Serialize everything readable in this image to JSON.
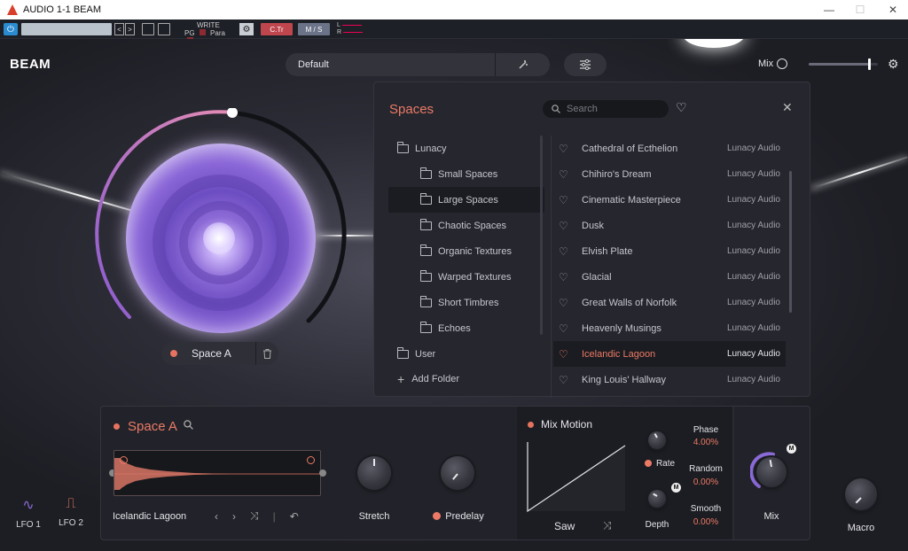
{
  "window": {
    "title": "AUDIO 1-1 BEAM",
    "minimize": "—",
    "maximize": "☐",
    "close": "✕"
  },
  "host": {
    "power": "⏻",
    "prev": "<",
    "next": ">",
    "write_label": "WRITE",
    "pg_label": "PG",
    "para_label": "Para",
    "gear": "⚙",
    "ctr_label": "C.Tr",
    "ms_label": "M / S",
    "l_label": "L",
    "r_label": "R"
  },
  "header": {
    "logo": "BEAM",
    "preset_name": "Default",
    "wand": "⁄̸",
    "mix_label": "Mix",
    "mix_fraction": 0.87
  },
  "space_pill": {
    "label": "Space A",
    "trash": "🗑"
  },
  "spaces_panel": {
    "title": "Spaces",
    "search_placeholder": "Search",
    "folders": [
      {
        "label": "Lunacy",
        "child": false,
        "active": false
      },
      {
        "label": "Small Spaces",
        "child": true,
        "active": false
      },
      {
        "label": "Large Spaces",
        "child": true,
        "active": true
      },
      {
        "label": "Chaotic Spaces",
        "child": true,
        "active": false
      },
      {
        "label": "Organic Textures",
        "child": true,
        "active": false
      },
      {
        "label": "Warped Textures",
        "child": true,
        "active": false
      },
      {
        "label": "Short Timbres",
        "child": true,
        "active": false
      },
      {
        "label": "Echoes",
        "child": true,
        "active": false
      },
      {
        "label": "User",
        "child": false,
        "active": false
      }
    ],
    "add_folder": "Add Folder",
    "presets": [
      {
        "name": "Cathedral of Ecthelion",
        "author": "Lunacy Audio",
        "active": false
      },
      {
        "name": "Chihiro's Dream",
        "author": "Lunacy Audio",
        "active": false
      },
      {
        "name": "Cinematic Masterpiece",
        "author": "Lunacy Audio",
        "active": false
      },
      {
        "name": "Dusk",
        "author": "Lunacy Audio",
        "active": false
      },
      {
        "name": "Elvish Plate",
        "author": "Lunacy Audio",
        "active": false
      },
      {
        "name": "Glacial",
        "author": "Lunacy Audio",
        "active": false
      },
      {
        "name": "Great Walls of Norfolk",
        "author": "Lunacy Audio",
        "active": false
      },
      {
        "name": "Heavenly Musings",
        "author": "Lunacy Audio",
        "active": false
      },
      {
        "name": "Icelandic Lagoon",
        "author": "Lunacy Audio",
        "active": true
      },
      {
        "name": "King Louis' Hallway",
        "author": "Lunacy Audio",
        "active": false
      }
    ]
  },
  "space_section": {
    "title": "Space A",
    "sample_name": "Icelandic Lagoon",
    "stretch_label": "Stretch",
    "predelay_label": "Predelay"
  },
  "mix_motion": {
    "title": "Mix Motion",
    "shape": "Saw",
    "rate_label": "Rate",
    "depth_label": "Depth",
    "phase_label": "Phase",
    "phase_value": "4.00%",
    "random_label": "Random",
    "random_value": "0.00%",
    "smooth_label": "Smooth",
    "smooth_value": "0.00%",
    "mix_label": "Mix",
    "m_badge": "M"
  },
  "lfos": {
    "lfo1": "LFO 1",
    "lfo2": "LFO 2"
  },
  "macro": {
    "label": "Macro"
  },
  "colors": {
    "accent": "#ec7a66",
    "panel": "#26272e",
    "background": "#1b1c21"
  }
}
